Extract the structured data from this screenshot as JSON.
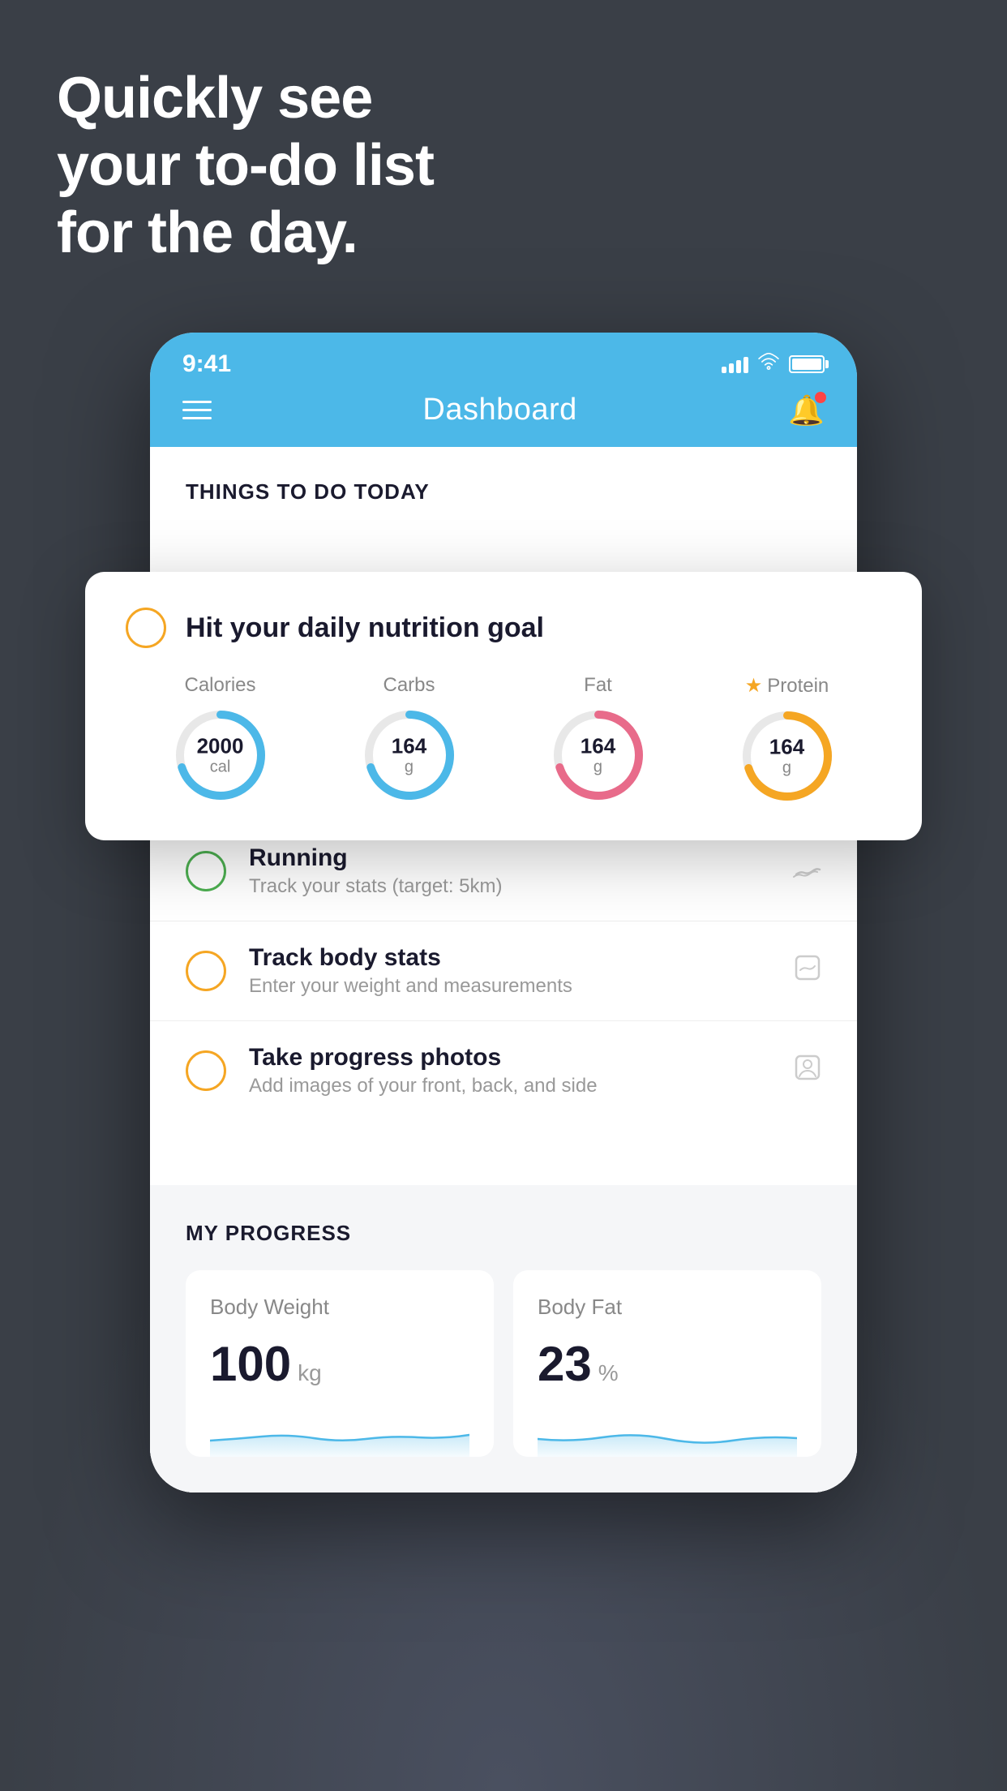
{
  "hero": {
    "line1": "Quickly see",
    "line2": "your to-do list",
    "line3": "for the day."
  },
  "statusBar": {
    "time": "9:41"
  },
  "navbar": {
    "title": "Dashboard"
  },
  "thingsToDo": {
    "sectionTitle": "THINGS TO DO TODAY"
  },
  "nutritionCard": {
    "title": "Hit your daily nutrition goal",
    "items": [
      {
        "label": "Calories",
        "value": "2000",
        "unit": "cal",
        "color": "blue",
        "starred": false
      },
      {
        "label": "Carbs",
        "value": "164",
        "unit": "g",
        "color": "blue",
        "starred": false
      },
      {
        "label": "Fat",
        "value": "164",
        "unit": "g",
        "color": "red",
        "starred": false
      },
      {
        "label": "Protein",
        "value": "164",
        "unit": "g",
        "color": "yellow",
        "starred": true
      }
    ]
  },
  "listItems": [
    {
      "title": "Running",
      "subtitle": "Track your stats (target: 5km)",
      "circleColor": "green",
      "icon": "👟"
    },
    {
      "title": "Track body stats",
      "subtitle": "Enter your weight and measurements",
      "circleColor": "yellow",
      "icon": "⚖️"
    },
    {
      "title": "Take progress photos",
      "subtitle": "Add images of your front, back, and side",
      "circleColor": "yellow",
      "icon": "👤"
    }
  ],
  "progress": {
    "sectionTitle": "MY PROGRESS",
    "cards": [
      {
        "title": "Body Weight",
        "value": "100",
        "unit": "kg"
      },
      {
        "title": "Body Fat",
        "value": "23",
        "unit": "%"
      }
    ]
  }
}
